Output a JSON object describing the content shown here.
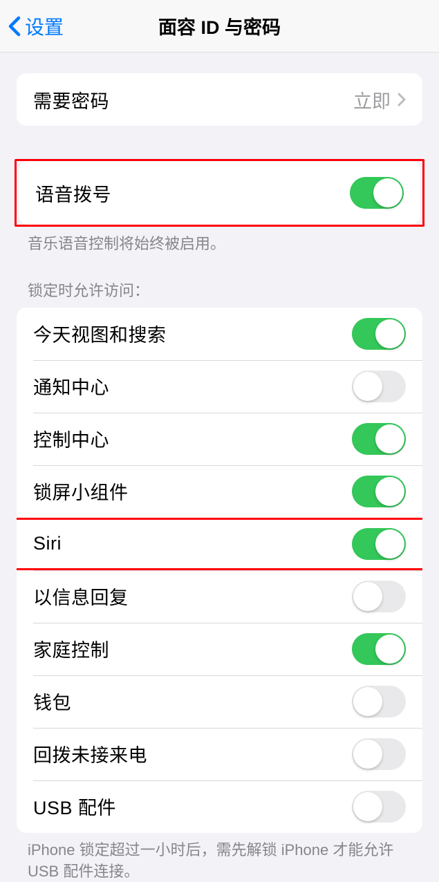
{
  "nav": {
    "back_label": "设置",
    "title": "面容 ID 与密码"
  },
  "require_passcode": {
    "label": "需要密码",
    "value": "立即"
  },
  "voice_dial": {
    "label": "语音拨号",
    "on": true,
    "footer": "音乐语音控制将始终被启用。"
  },
  "locked_access": {
    "header": "锁定时允许访问：",
    "items": [
      {
        "label": "今天视图和搜索",
        "on": true
      },
      {
        "label": "通知中心",
        "on": false
      },
      {
        "label": "控制中心",
        "on": true
      },
      {
        "label": "锁屏小组件",
        "on": true
      },
      {
        "label": "Siri",
        "on": true
      },
      {
        "label": "以信息回复",
        "on": false
      },
      {
        "label": "家庭控制",
        "on": true
      },
      {
        "label": "钱包",
        "on": false
      },
      {
        "label": "回拨未接来电",
        "on": false
      },
      {
        "label": "USB 配件",
        "on": false
      }
    ],
    "footer": "iPhone 锁定超过一小时后，需先解锁 iPhone 才能允许 USB 配件连接。"
  },
  "highlighted_rows": [
    4
  ]
}
